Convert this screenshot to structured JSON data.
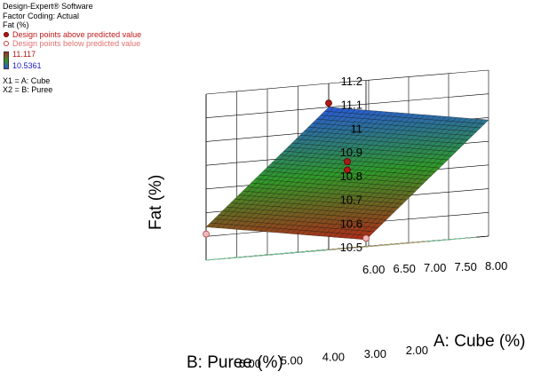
{
  "info": {
    "software": "Design-Expert® Software",
    "coding": "Factor Coding: Actual",
    "response": "Fat (%)",
    "legend_above": "Design points above predicted value",
    "legend_below": "Design points below predicted value",
    "range_max": "11.117",
    "range_min": "10.5361",
    "x1": "X1 = A: Cube",
    "x2": "X2 = B: Puree"
  },
  "colors": {
    "surface_low": "#b02a1a",
    "surface_mid": "#2f9a28",
    "surface_high": "#2a5ad8",
    "floor": "#ffff00",
    "point_above": "#b01818",
    "point_below": "#f0b8b8"
  },
  "chart_data": {
    "type": "surface3d",
    "title": "",
    "zlabel": "Fat (%)",
    "xlabel": "A: Cube (%)",
    "ylabel": "B: Puree (%)",
    "x_ticks": [
      "6.00",
      "6.50",
      "7.00",
      "7.50",
      "8.00"
    ],
    "y_ticks": [
      "2.00",
      "3.00",
      "4.00",
      "5.00",
      "6.00"
    ],
    "z_ticks": [
      "10.5",
      "10.6",
      "10.7",
      "10.8",
      "10.9",
      "11",
      "11.1",
      "11.2"
    ],
    "xlim": [
      6,
      8
    ],
    "ylim": [
      2,
      6
    ],
    "zlim": [
      10.5,
      11.2
    ],
    "surface_corners": [
      {
        "A": 6,
        "B": 2,
        "fat": 10.53
      },
      {
        "A": 8,
        "B": 2,
        "fat": 10.99
      },
      {
        "A": 6,
        "B": 6,
        "fat": 10.64
      },
      {
        "A": 8,
        "B": 6,
        "fat": 11.1
      }
    ],
    "design_points": [
      {
        "A": 8,
        "B": 6,
        "fat": 11.117,
        "position": "above"
      },
      {
        "A": 7,
        "B": 4,
        "fat": 10.83,
        "position": "above"
      },
      {
        "A": 6,
        "B": 2,
        "fat": 10.5361,
        "position": "below"
      },
      {
        "A": 6,
        "B": 6,
        "fat": 10.61,
        "position": "below"
      }
    ],
    "floor_contours": true,
    "grid": true
  }
}
